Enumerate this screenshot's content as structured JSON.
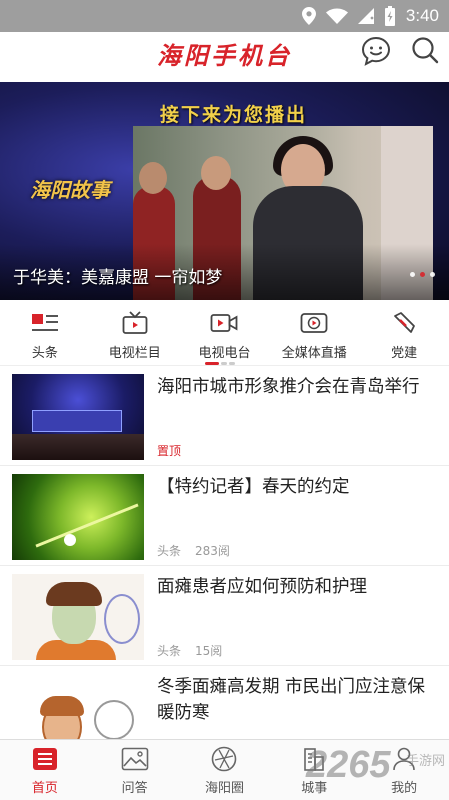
{
  "status_bar": {
    "time": "3:40",
    "icons": [
      "location-icon",
      "wifi-icon",
      "signal-icon",
      "battery-icon"
    ]
  },
  "header": {
    "title": "海阳手机台",
    "icons": [
      "chat-icon",
      "search-icon"
    ],
    "accent_color": "#d8232a"
  },
  "banner": {
    "top_caption": "接下来为您播出",
    "logo_caption": "海阳故事",
    "caption": "于华美：美嘉康盟  一帘如梦",
    "dots_count": 3,
    "active_dot": 1
  },
  "categories": [
    {
      "label": "头条",
      "icon": "headline-icon"
    },
    {
      "label": "电视栏目",
      "icon": "tv-icon"
    },
    {
      "label": "电视电台",
      "icon": "video-camera-icon"
    },
    {
      "label": "全媒体直播",
      "icon": "live-play-icon"
    },
    {
      "label": "党建",
      "icon": "party-building-icon"
    }
  ],
  "news": [
    {
      "title": "海阳市城市形象推介会在青岛举行",
      "tag": "置顶",
      "views": ""
    },
    {
      "title": "【特约记者】春天的约定",
      "tag": "头条",
      "views": "283阅"
    },
    {
      "title": "面瘫患者应如何预防和护理",
      "tag": "头条",
      "views": "15阅"
    },
    {
      "title": "冬季面瘫高发期 市民出门应注意保暖防寒",
      "tag": "",
      "views": ""
    }
  ],
  "bottom_nav": [
    {
      "label": "首页",
      "icon": "home-list-icon",
      "active": true
    },
    {
      "label": "问答",
      "icon": "image-icon",
      "active": false
    },
    {
      "label": "海阳圈",
      "icon": "circle-icon",
      "active": false
    },
    {
      "label": "城事",
      "icon": "city-icon",
      "active": false
    },
    {
      "label": "我的",
      "icon": "user-icon",
      "active": false
    }
  ],
  "watermark": {
    "number": "2265",
    "text": "手游网"
  }
}
